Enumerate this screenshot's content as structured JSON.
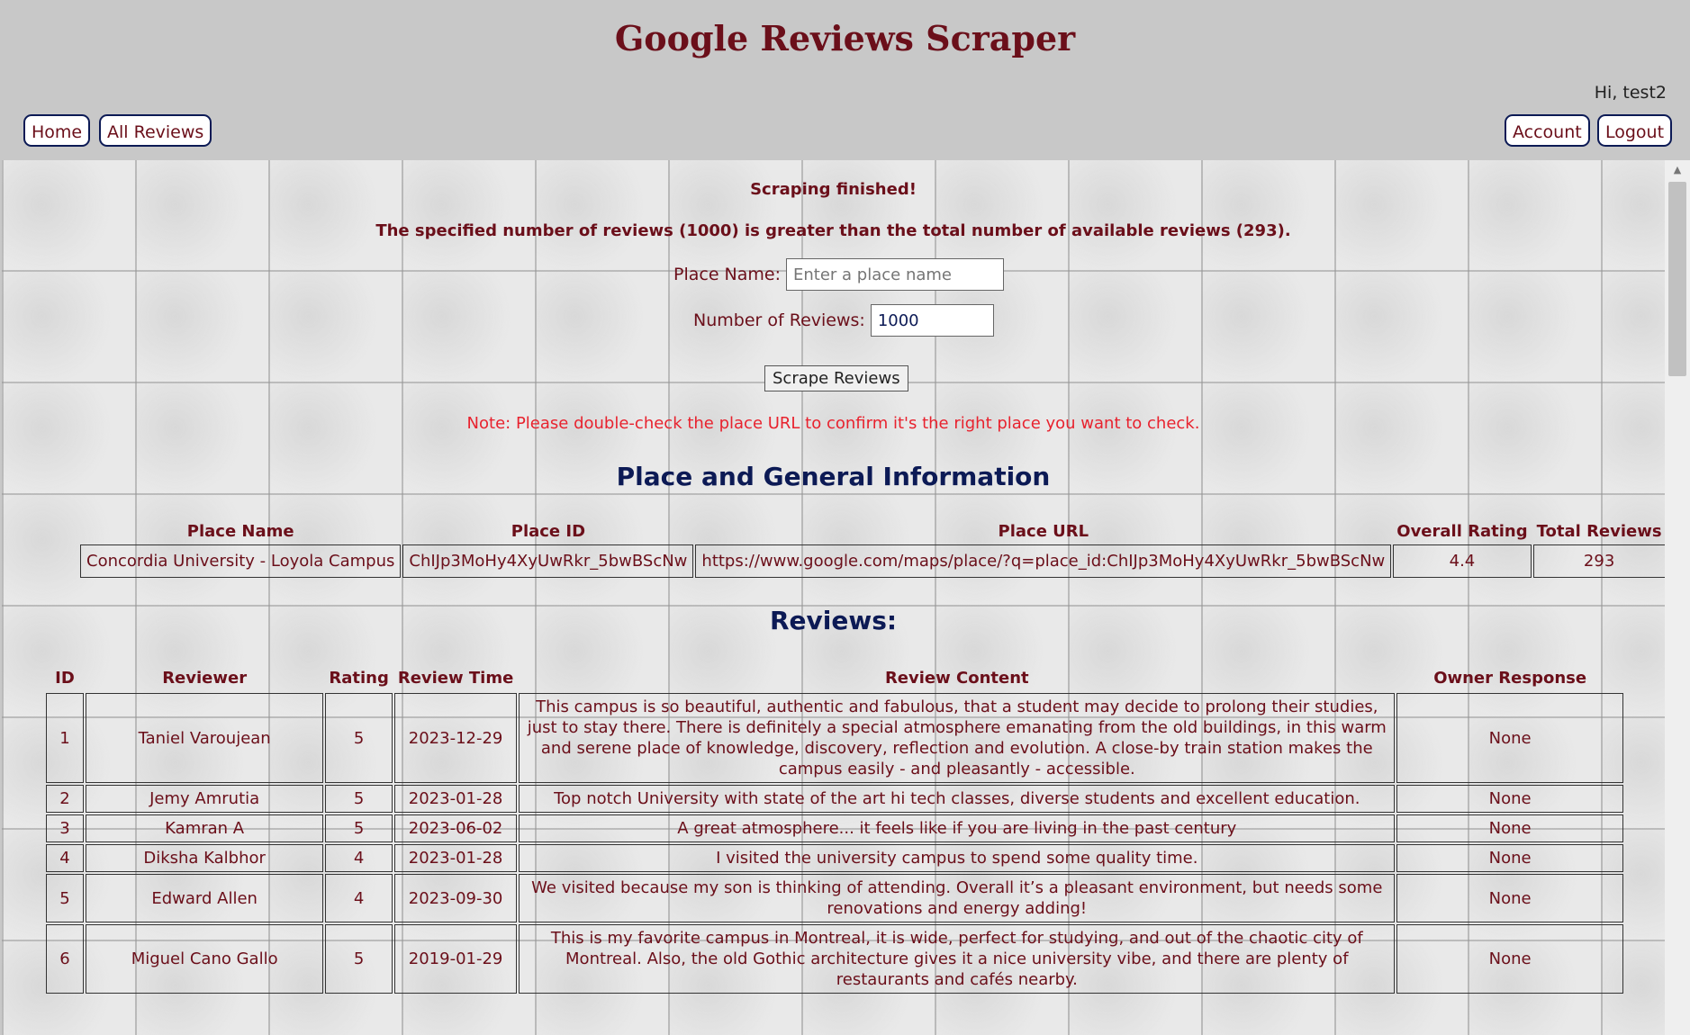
{
  "header": {
    "title": "Google Reviews Scraper",
    "greeting": "Hi, test2",
    "nav_left": [
      "Home",
      "All Reviews"
    ],
    "nav_right": [
      "Account",
      "Logout"
    ]
  },
  "status": {
    "finished": "Scraping finished!",
    "warning": "The specified number of reviews (1000) is greater than the total number of available reviews (293)."
  },
  "form": {
    "place_label": "Place Name:",
    "place_placeholder": "Enter a place name",
    "place_value": "",
    "count_label": "Number of Reviews:",
    "count_value": "1000",
    "submit_label": "Scrape Reviews",
    "note": "Note: Please double-check the place URL to confirm it's the right place you want to check."
  },
  "place": {
    "section_title": "Place and General Information",
    "headers": [
      "Place Name",
      "Place ID",
      "Place URL",
      "Overall Rating",
      "Total Reviews"
    ],
    "row": [
      "Concordia University - Loyola Campus",
      "ChIJp3MoHy4XyUwRkr_5bwBScNw",
      "https://www.google.com/maps/place/?q=place_id:ChIJp3MoHy4XyUwRkr_5bwBScNw",
      "4.4",
      "293"
    ]
  },
  "reviews": {
    "section_title": "Reviews:",
    "headers": [
      "ID",
      "Reviewer",
      "Rating",
      "Review Time",
      "Review Content",
      "Owner Response"
    ],
    "rows": [
      [
        "1",
        "Taniel Varoujean",
        "5",
        "2023-12-29",
        "This campus is so beautiful, authentic and fabulous, that a student may decide to prolong their studies, just to stay there. There is definitely a special atmosphere emanating from the old buildings, in this warm and serene place of knowledge, discovery, reflection and evolution. A close-by train station makes the campus easily - and pleasantly - accessible.",
        "None"
      ],
      [
        "2",
        "Jemy Amrutia",
        "5",
        "2023-01-28",
        "Top notch University with state of the art hi tech classes, diverse students and excellent education.",
        "None"
      ],
      [
        "3",
        "Kamran A",
        "5",
        "2023-06-02",
        "A great atmosphere... it feels like if you are living in the past century",
        "None"
      ],
      [
        "4",
        "Diksha Kalbhor",
        "4",
        "2023-01-28",
        "I visited the university campus to spend some quality time.",
        "None"
      ],
      [
        "5",
        "Edward Allen",
        "4",
        "2023-09-30",
        "We visited because my son is thinking of attending. Overall it’s a pleasant environment, but needs some renovations and energy adding!",
        "None"
      ],
      [
        "6",
        "Miguel Cano Gallo",
        "5",
        "2019-01-29",
        "This is my favorite campus in Montreal, it is wide, perfect for studying, and out of the chaotic city of Montreal. Also, the old Gothic architecture gives it a nice university vibe, and there are plenty of restaurants and cafés nearby.",
        "None"
      ]
    ]
  }
}
